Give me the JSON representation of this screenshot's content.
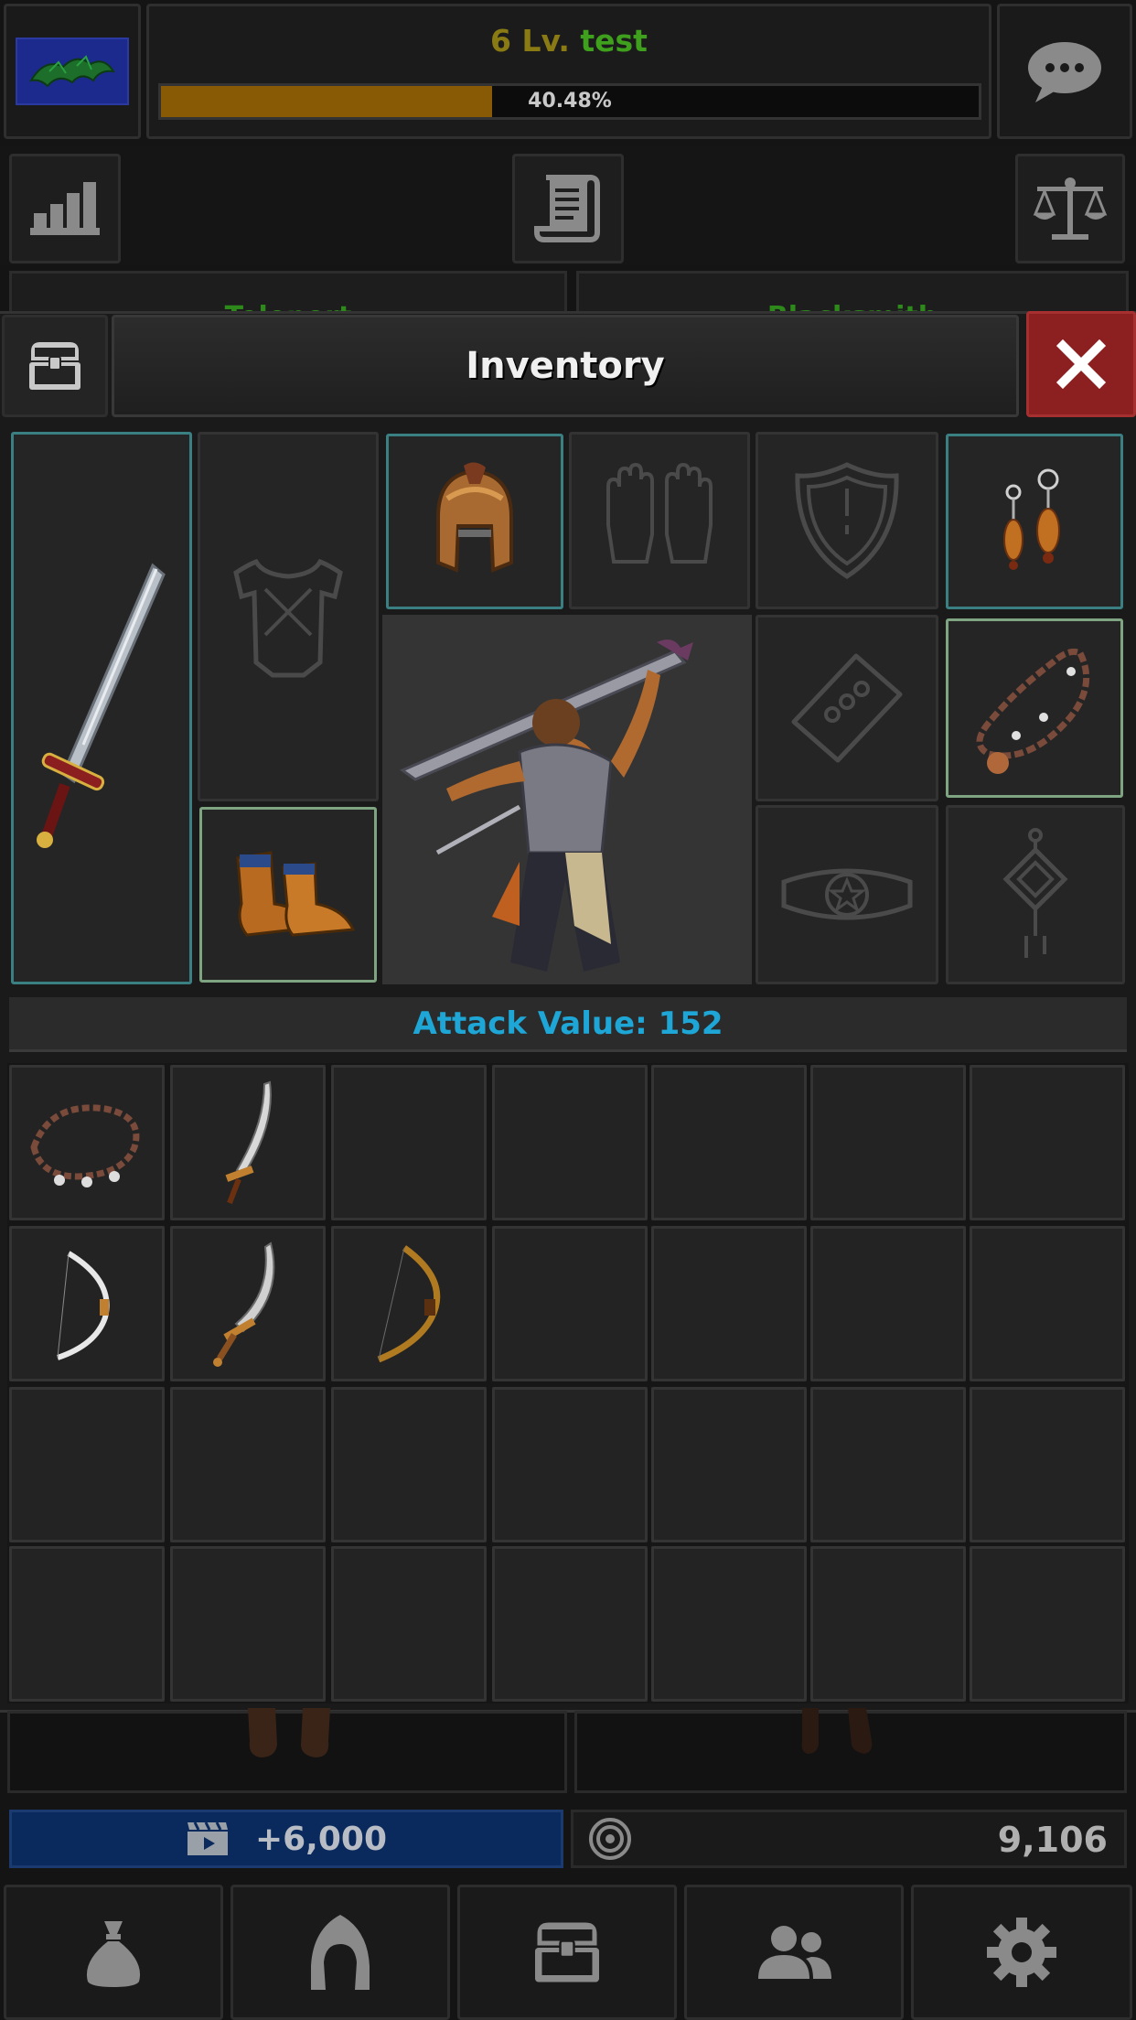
{
  "player": {
    "level_text": "6 Lv.",
    "name": "test",
    "xp_percent_text": "40.48%",
    "xp_fraction": 0.4048
  },
  "background_tabs": {
    "left_label": "Teleport",
    "right_label": "Blacksmith"
  },
  "inventory": {
    "title": "Inventory",
    "attack_value_text": "Attack Value: 152",
    "equipped": {
      "weapon": "sword",
      "armor": "empty",
      "helmet": "helmet",
      "gloves": "empty",
      "shield": "empty",
      "earrings": "earrings",
      "bracelet": "empty",
      "necklace": "necklace",
      "shoes": "boots",
      "belt": "empty",
      "talisman": "empty"
    },
    "bag_items": [
      [
        "necklace",
        "curved-sword",
        "",
        "",
        "",
        "",
        ""
      ],
      [
        "bow-white",
        "scimitar",
        "bow-gold",
        "",
        "",
        "",
        ""
      ],
      [
        "",
        "",
        "",
        "",
        "",
        "",
        ""
      ],
      [
        "",
        "",
        "",
        "",
        "",
        "",
        ""
      ]
    ]
  },
  "currency": {
    "ad_reward_text": "+6,000",
    "coins_text": "9,106"
  },
  "colors": {
    "xp_fill": "#885a06",
    "level_text": "#8a7a14",
    "name_text": "#3ea01c",
    "attack_text": "#1ea7d6",
    "close_button": "#8c1f1f",
    "ad_button": "#0a2a5e",
    "teal_border": "#3a7f82",
    "green_border": "#7fa482"
  },
  "icons": {
    "guild_emblem": "dragon-emblem-icon",
    "chat": "chat-bubble-icon",
    "stats": "bar-chart-icon",
    "quests": "scroll-icon",
    "trade": "balance-scale-icon",
    "inventory_header": "chest-icon",
    "close": "close-icon",
    "ad": "video-clapper-icon",
    "coin": "coin-icon",
    "nav": [
      "loot-bag-icon",
      "hood-icon",
      "chest-icon",
      "friends-icon",
      "gear-icon"
    ]
  }
}
